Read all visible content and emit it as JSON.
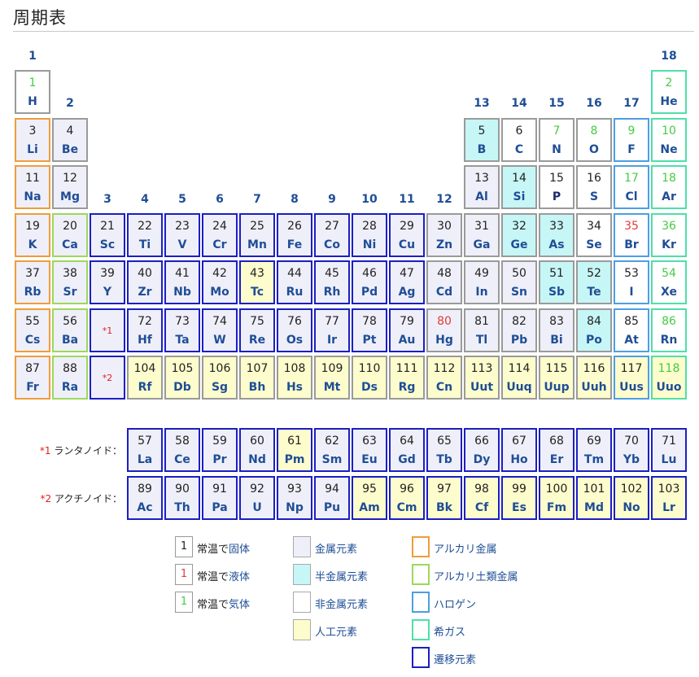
{
  "title": "周期表",
  "group_labels": [
    "1",
    "2",
    "3",
    "4",
    "5",
    "6",
    "7",
    "8",
    "9",
    "10",
    "11",
    "12",
    "13",
    "14",
    "15",
    "16",
    "17",
    "18"
  ],
  "main_table": [
    {
      "n": "1",
      "s": "H",
      "g": 1,
      "p": 1,
      "fill": "nonmetal",
      "border": "grey",
      "state": "gas"
    },
    {
      "n": "2",
      "s": "He",
      "g": 18,
      "p": 1,
      "fill": "nonmetal",
      "border": "noble",
      "state": "gas"
    },
    {
      "n": "3",
      "s": "Li",
      "g": 1,
      "p": 2,
      "fill": "metal",
      "border": "alkali"
    },
    {
      "n": "4",
      "s": "Be",
      "g": 2,
      "p": 2,
      "fill": "metal",
      "border": "grey"
    },
    {
      "n": "5",
      "s": "B",
      "g": 13,
      "p": 2,
      "fill": "semi",
      "border": "grey"
    },
    {
      "n": "6",
      "s": "C",
      "g": 14,
      "p": 2,
      "fill": "nonmetal",
      "border": "grey"
    },
    {
      "n": "7",
      "s": "N",
      "g": 15,
      "p": 2,
      "fill": "nonmetal",
      "border": "grey",
      "state": "gas"
    },
    {
      "n": "8",
      "s": "O",
      "g": 16,
      "p": 2,
      "fill": "nonmetal",
      "border": "grey",
      "state": "gas"
    },
    {
      "n": "9",
      "s": "F",
      "g": 17,
      "p": 2,
      "fill": "nonmetal",
      "border": "halogen",
      "state": "gas"
    },
    {
      "n": "10",
      "s": "Ne",
      "g": 18,
      "p": 2,
      "fill": "nonmetal",
      "border": "noble",
      "state": "gas"
    },
    {
      "n": "11",
      "s": "Na",
      "g": 1,
      "p": 3,
      "fill": "metal",
      "border": "alkali"
    },
    {
      "n": "12",
      "s": "Mg",
      "g": 2,
      "p": 3,
      "fill": "metal",
      "border": "grey"
    },
    {
      "n": "13",
      "s": "Al",
      "g": 13,
      "p": 3,
      "fill": "metal",
      "border": "grey"
    },
    {
      "n": "14",
      "s": "Si",
      "g": 14,
      "p": 3,
      "fill": "semi",
      "border": "grey"
    },
    {
      "n": "15",
      "s": "P",
      "g": 15,
      "p": 3,
      "fill": "nonmetal",
      "border": "grey",
      "dark": true
    },
    {
      "n": "16",
      "s": "S",
      "g": 16,
      "p": 3,
      "fill": "nonmetal",
      "border": "grey"
    },
    {
      "n": "17",
      "s": "Cl",
      "g": 17,
      "p": 3,
      "fill": "nonmetal",
      "border": "halogen",
      "state": "gas"
    },
    {
      "n": "18",
      "s": "Ar",
      "g": 18,
      "p": 3,
      "fill": "nonmetal",
      "border": "noble",
      "state": "gas"
    },
    {
      "n": "19",
      "s": "K",
      "g": 1,
      "p": 4,
      "fill": "metal",
      "border": "alkali"
    },
    {
      "n": "20",
      "s": "Ca",
      "g": 2,
      "p": 4,
      "fill": "metal",
      "border": "alkearth"
    },
    {
      "n": "21",
      "s": "Sc",
      "g": 3,
      "p": 4,
      "fill": "metal",
      "border": "transition"
    },
    {
      "n": "22",
      "s": "Ti",
      "g": 4,
      "p": 4,
      "fill": "metal",
      "border": "transition"
    },
    {
      "n": "23",
      "s": "V",
      "g": 5,
      "p": 4,
      "fill": "metal",
      "border": "transition"
    },
    {
      "n": "24",
      "s": "Cr",
      "g": 6,
      "p": 4,
      "fill": "metal",
      "border": "transition"
    },
    {
      "n": "25",
      "s": "Mn",
      "g": 7,
      "p": 4,
      "fill": "metal",
      "border": "transition"
    },
    {
      "n": "26",
      "s": "Fe",
      "g": 8,
      "p": 4,
      "fill": "metal",
      "border": "transition"
    },
    {
      "n": "27",
      "s": "Co",
      "g": 9,
      "p": 4,
      "fill": "metal",
      "border": "transition"
    },
    {
      "n": "28",
      "s": "Ni",
      "g": 10,
      "p": 4,
      "fill": "metal",
      "border": "transition"
    },
    {
      "n": "29",
      "s": "Cu",
      "g": 11,
      "p": 4,
      "fill": "metal",
      "border": "transition"
    },
    {
      "n": "30",
      "s": "Zn",
      "g": 12,
      "p": 4,
      "fill": "metal",
      "border": "grey"
    },
    {
      "n": "31",
      "s": "Ga",
      "g": 13,
      "p": 4,
      "fill": "metal",
      "border": "grey"
    },
    {
      "n": "32",
      "s": "Ge",
      "g": 14,
      "p": 4,
      "fill": "semi",
      "border": "grey"
    },
    {
      "n": "33",
      "s": "As",
      "g": 15,
      "p": 4,
      "fill": "semi",
      "border": "grey"
    },
    {
      "n": "34",
      "s": "Se",
      "g": 16,
      "p": 4,
      "fill": "nonmetal",
      "border": "grey"
    },
    {
      "n": "35",
      "s": "Br",
      "g": 17,
      "p": 4,
      "fill": "nonmetal",
      "border": "halogen",
      "state": "liquid"
    },
    {
      "n": "36",
      "s": "Kr",
      "g": 18,
      "p": 4,
      "fill": "nonmetal",
      "border": "noble",
      "state": "gas"
    },
    {
      "n": "37",
      "s": "Rb",
      "g": 1,
      "p": 5,
      "fill": "metal",
      "border": "alkali"
    },
    {
      "n": "38",
      "s": "Sr",
      "g": 2,
      "p": 5,
      "fill": "metal",
      "border": "alkearth"
    },
    {
      "n": "39",
      "s": "Y",
      "g": 3,
      "p": 5,
      "fill": "metal",
      "border": "transition"
    },
    {
      "n": "40",
      "s": "Zr",
      "g": 4,
      "p": 5,
      "fill": "metal",
      "border": "transition"
    },
    {
      "n": "41",
      "s": "Nb",
      "g": 5,
      "p": 5,
      "fill": "metal",
      "border": "transition"
    },
    {
      "n": "42",
      "s": "Mo",
      "g": 6,
      "p": 5,
      "fill": "metal",
      "border": "transition"
    },
    {
      "n": "43",
      "s": "Tc",
      "g": 7,
      "p": 5,
      "fill": "artificial",
      "border": "transition"
    },
    {
      "n": "44",
      "s": "Ru",
      "g": 8,
      "p": 5,
      "fill": "metal",
      "border": "transition"
    },
    {
      "n": "45",
      "s": "Rh",
      "g": 9,
      "p": 5,
      "fill": "metal",
      "border": "transition"
    },
    {
      "n": "46",
      "s": "Pd",
      "g": 10,
      "p": 5,
      "fill": "metal",
      "border": "transition"
    },
    {
      "n": "47",
      "s": "Ag",
      "g": 11,
      "p": 5,
      "fill": "metal",
      "border": "transition"
    },
    {
      "n": "48",
      "s": "Cd",
      "g": 12,
      "p": 5,
      "fill": "metal",
      "border": "grey"
    },
    {
      "n": "49",
      "s": "In",
      "g": 13,
      "p": 5,
      "fill": "metal",
      "border": "grey"
    },
    {
      "n": "50",
      "s": "Sn",
      "g": 14,
      "p": 5,
      "fill": "metal",
      "border": "grey"
    },
    {
      "n": "51",
      "s": "Sb",
      "g": 15,
      "p": 5,
      "fill": "semi",
      "border": "grey"
    },
    {
      "n": "52",
      "s": "Te",
      "g": 16,
      "p": 5,
      "fill": "semi",
      "border": "grey"
    },
    {
      "n": "53",
      "s": "I",
      "g": 17,
      "p": 5,
      "fill": "nonmetal",
      "border": "halogen"
    },
    {
      "n": "54",
      "s": "Xe",
      "g": 18,
      "p": 5,
      "fill": "nonmetal",
      "border": "noble",
      "state": "gas"
    },
    {
      "n": "55",
      "s": "Cs",
      "g": 1,
      "p": 6,
      "fill": "metal",
      "border": "alkali"
    },
    {
      "n": "56",
      "s": "Ba",
      "g": 2,
      "p": 6,
      "fill": "metal",
      "border": "alkearth"
    },
    {
      "n": "",
      "s": "",
      "g": 3,
      "p": 6,
      "fill": "metal",
      "border": "transition",
      "ref": "*1"
    },
    {
      "n": "72",
      "s": "Hf",
      "g": 4,
      "p": 6,
      "fill": "metal",
      "border": "transition"
    },
    {
      "n": "73",
      "s": "Ta",
      "g": 5,
      "p": 6,
      "fill": "metal",
      "border": "transition"
    },
    {
      "n": "74",
      "s": "W",
      "g": 6,
      "p": 6,
      "fill": "metal",
      "border": "transition"
    },
    {
      "n": "75",
      "s": "Re",
      "g": 7,
      "p": 6,
      "fill": "metal",
      "border": "transition"
    },
    {
      "n": "76",
      "s": "Os",
      "g": 8,
      "p": 6,
      "fill": "metal",
      "border": "transition"
    },
    {
      "n": "77",
      "s": "Ir",
      "g": 9,
      "p": 6,
      "fill": "metal",
      "border": "transition"
    },
    {
      "n": "78",
      "s": "Pt",
      "g": 10,
      "p": 6,
      "fill": "metal",
      "border": "transition"
    },
    {
      "n": "79",
      "s": "Au",
      "g": 11,
      "p": 6,
      "fill": "metal",
      "border": "transition"
    },
    {
      "n": "80",
      "s": "Hg",
      "g": 12,
      "p": 6,
      "fill": "metal",
      "border": "grey",
      "state": "liquid"
    },
    {
      "n": "81",
      "s": "Tl",
      "g": 13,
      "p": 6,
      "fill": "metal",
      "border": "grey"
    },
    {
      "n": "82",
      "s": "Pb",
      "g": 14,
      "p": 6,
      "fill": "metal",
      "border": "grey"
    },
    {
      "n": "83",
      "s": "Bi",
      "g": 15,
      "p": 6,
      "fill": "metal",
      "border": "grey"
    },
    {
      "n": "84",
      "s": "Po",
      "g": 16,
      "p": 6,
      "fill": "semi",
      "border": "grey"
    },
    {
      "n": "85",
      "s": "At",
      "g": 17,
      "p": 6,
      "fill": "nonmetal",
      "border": "halogen"
    },
    {
      "n": "86",
      "s": "Rn",
      "g": 18,
      "p": 6,
      "fill": "nonmetal",
      "border": "noble",
      "state": "gas"
    },
    {
      "n": "87",
      "s": "Fr",
      "g": 1,
      "p": 7,
      "fill": "metal",
      "border": "alkali"
    },
    {
      "n": "88",
      "s": "Ra",
      "g": 2,
      "p": 7,
      "fill": "metal",
      "border": "alkearth"
    },
    {
      "n": "",
      "s": "",
      "g": 3,
      "p": 7,
      "fill": "metal",
      "border": "transition",
      "ref": "*2"
    },
    {
      "n": "104",
      "s": "Rf",
      "g": 4,
      "p": 7,
      "fill": "artificial",
      "border": "grey"
    },
    {
      "n": "105",
      "s": "Db",
      "g": 5,
      "p": 7,
      "fill": "artificial",
      "border": "grey"
    },
    {
      "n": "106",
      "s": "Sg",
      "g": 6,
      "p": 7,
      "fill": "artificial",
      "border": "grey"
    },
    {
      "n": "107",
      "s": "Bh",
      "g": 7,
      "p": 7,
      "fill": "artificial",
      "border": "grey"
    },
    {
      "n": "108",
      "s": "Hs",
      "g": 8,
      "p": 7,
      "fill": "artificial",
      "border": "grey"
    },
    {
      "n": "109",
      "s": "Mt",
      "g": 9,
      "p": 7,
      "fill": "artificial",
      "border": "grey"
    },
    {
      "n": "110",
      "s": "Ds",
      "g": 10,
      "p": 7,
      "fill": "artificial",
      "border": "grey"
    },
    {
      "n": "111",
      "s": "Rg",
      "g": 11,
      "p": 7,
      "fill": "artificial",
      "border": "grey"
    },
    {
      "n": "112",
      "s": "Cn",
      "g": 12,
      "p": 7,
      "fill": "artificial",
      "border": "grey"
    },
    {
      "n": "113",
      "s": "Uut",
      "g": 13,
      "p": 7,
      "fill": "artificial",
      "border": "grey"
    },
    {
      "n": "114",
      "s": "Uuq",
      "g": 14,
      "p": 7,
      "fill": "artificial",
      "border": "grey"
    },
    {
      "n": "115",
      "s": "Uup",
      "g": 15,
      "p": 7,
      "fill": "artificial",
      "border": "grey"
    },
    {
      "n": "116",
      "s": "Uuh",
      "g": 16,
      "p": 7,
      "fill": "artificial",
      "border": "grey"
    },
    {
      "n": "117",
      "s": "Uus",
      "g": 17,
      "p": 7,
      "fill": "artificial",
      "border": "halogen"
    },
    {
      "n": "118",
      "s": "Uuo",
      "g": 18,
      "p": 7,
      "fill": "artificial",
      "border": "noble",
      "state": "gas"
    }
  ],
  "lanthanides": {
    "mark": "*1",
    "label": " ランタノイド：",
    "elements": [
      {
        "n": "57",
        "s": "La",
        "fill": "metal"
      },
      {
        "n": "58",
        "s": "Ce",
        "fill": "metal"
      },
      {
        "n": "59",
        "s": "Pr",
        "fill": "metal"
      },
      {
        "n": "60",
        "s": "Nd",
        "fill": "metal"
      },
      {
        "n": "61",
        "s": "Pm",
        "fill": "artificial"
      },
      {
        "n": "62",
        "s": "Sm",
        "fill": "metal"
      },
      {
        "n": "63",
        "s": "Eu",
        "fill": "metal"
      },
      {
        "n": "64",
        "s": "Gd",
        "fill": "metal"
      },
      {
        "n": "65",
        "s": "Tb",
        "fill": "metal"
      },
      {
        "n": "66",
        "s": "Dy",
        "fill": "metal"
      },
      {
        "n": "67",
        "s": "Ho",
        "fill": "metal"
      },
      {
        "n": "68",
        "s": "Er",
        "fill": "metal"
      },
      {
        "n": "69",
        "s": "Tm",
        "fill": "metal"
      },
      {
        "n": "70",
        "s": "Yb",
        "fill": "metal"
      },
      {
        "n": "71",
        "s": "Lu",
        "fill": "metal"
      }
    ]
  },
  "actinides": {
    "mark": "*2",
    "label": " アクチノイド：",
    "elements": [
      {
        "n": "89",
        "s": "Ac",
        "fill": "metal"
      },
      {
        "n": "90",
        "s": "Th",
        "fill": "metal"
      },
      {
        "n": "91",
        "s": "Pa",
        "fill": "metal"
      },
      {
        "n": "92",
        "s": "U",
        "fill": "metal"
      },
      {
        "n": "93",
        "s": "Np",
        "fill": "metal"
      },
      {
        "n": "94",
        "s": "Pu",
        "fill": "metal"
      },
      {
        "n": "95",
        "s": "Am",
        "fill": "artificial"
      },
      {
        "n": "96",
        "s": "Cm",
        "fill": "artificial"
      },
      {
        "n": "97",
        "s": "Bk",
        "fill": "artificial"
      },
      {
        "n": "98",
        "s": "Cf",
        "fill": "artificial"
      },
      {
        "n": "99",
        "s": "Es",
        "fill": "artificial"
      },
      {
        "n": "100",
        "s": "Fm",
        "fill": "artificial"
      },
      {
        "n": "101",
        "s": "Md",
        "fill": "artificial"
      },
      {
        "n": "102",
        "s": "No",
        "fill": "artificial"
      },
      {
        "n": "103",
        "s": "Lr",
        "fill": "artificial"
      }
    ]
  },
  "legend": {
    "states": [
      {
        "swatch": "1",
        "pre": "常温で",
        "text": "固体",
        "color": "#222222"
      },
      {
        "swatch": "1",
        "pre": "常温で",
        "text": "液体",
        "color": "#e23b3b"
      },
      {
        "swatch": "1",
        "pre": "常温で",
        "text": "気体",
        "color": "#44cc44"
      }
    ],
    "fills": [
      {
        "text": "金属元素",
        "fill": "#efeff9"
      },
      {
        "text": "半金属元素",
        "fill": "#c7f6f6"
      },
      {
        "text": "非金属元素",
        "fill": "#ffffff"
      },
      {
        "text": "人工元素",
        "fill": "#fdfccc"
      }
    ],
    "borders": [
      {
        "text": "アルカリ金属",
        "color": "#ef9d3a"
      },
      {
        "text": "アルカリ土類金属",
        "color": "#9cd85c"
      },
      {
        "text": "ハロゲン",
        "color": "#4d9ee3"
      },
      {
        "text": "希ガス",
        "color": "#4fdfa8"
      },
      {
        "text": "遷移元素",
        "color": "#1b1fc2"
      }
    ]
  },
  "colors": {
    "symbol": "#1f4e96",
    "metal": "#efeff9",
    "semimetal": "#c7f6f6",
    "nonmetal": "#ffffff",
    "artificial": "#fdfccc",
    "alkali": "#ef9d3a",
    "alkaline_earth": "#9cd85c",
    "halogen": "#4d9ee3",
    "noble_gas": "#4fdfa8",
    "transition": "#1b1fc2",
    "liquid": "#e23b3b",
    "gas": "#44cc44"
  }
}
